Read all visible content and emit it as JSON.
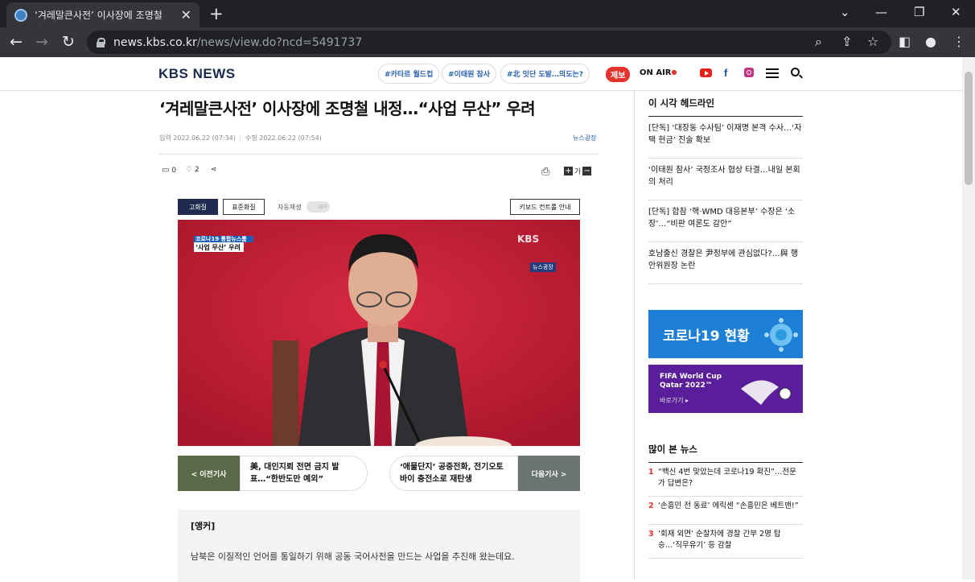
{
  "browser": {
    "tab_title": "‘겨레말큰사전’ 이사장에 조명철",
    "url_host": "news.kbs.co.kr",
    "url_path": "/news/view.do?ncd=5491737"
  },
  "header": {
    "logo": "KBS NEWS",
    "tags": [
      "#카타르 월드컵",
      "#이태원 참사",
      "#北 잇단 도발…의도는?"
    ],
    "jebo": "제보",
    "onair": "ON AIR"
  },
  "article": {
    "title": "‘겨레말큰사전’ 이사장에 조명철 내정…“사업 무산” 우려",
    "input_time": "입력 2022.06.22 (07:34)",
    "edit_time": "수정 2022.06.22 (07:54)",
    "category": "뉴스광장",
    "comments": "0",
    "likes": "2",
    "font_label": "가",
    "video": {
      "hq_button": "고화질",
      "sq_button": "표준화질",
      "autoplay_label": "자동재생",
      "autoplay_state": "OFF",
      "keyboard_button": "키보드 컨트롤 안내",
      "caption_top": "코로나19 통합뉴스룸",
      "caption_main": "‘사업 무산’ 우려",
      "watermark": "KBS",
      "program_badge": "뉴스광장"
    },
    "prev": {
      "label": "< 이전기사",
      "title": "美, 대인지뢰 전면 금지 발표…“한반도만 예외”"
    },
    "next": {
      "label": "다음기사 >",
      "title": "‘애물단지’ 공중전화, 전기오토바이 충전소로 재탄생"
    },
    "anchor": "[앵커]",
    "paragraph": "남북은 이질적인 언어를 통일하기 위해 공동 국어사전을 만드는 사업을 추진해 왔는데요."
  },
  "sidebar": {
    "headline_title": "이 시각 헤드라인",
    "headlines": [
      "[단독] ‘대장동 수사팀’ 이재명 본격 수사…‘자택 현금’ 진술 확보",
      "‘이태원 참사’ 국정조사 협상 타결…내일 본회의 처리",
      "[단독] 합참 ‘핵·WMD 대응본부’ 수장은 ‘소장’…“비판 여론도 감안”",
      "호남출신 경찰은 尹정부에 관심없다?…與 행안위원장 논란"
    ],
    "covid_banner": "코로나19 현황",
    "fifa_title": "FIFA World Cup Qatar 2022™",
    "fifa_link": "바로가기 ▸",
    "popular_title": "많이 본 뉴스",
    "popular": [
      {
        "rank": "1",
        "text": "“백신 4번 맞았는데 코로나19 확진”…전문가 답변은?"
      },
      {
        "rank": "2",
        "text": "‘손흥민 전 동료’ 에릭센 “손흥민은 베트맨!”"
      },
      {
        "rank": "3",
        "text": "‘회재 외면’ 순찰차에 경찰 간부 2명 탑승…‘직무유기’ 등 감찰"
      }
    ]
  },
  "colors": {
    "accent_red": "#e5322d",
    "kbs_navy": "#1a2b4c",
    "link_blue": "#2a64b0"
  }
}
